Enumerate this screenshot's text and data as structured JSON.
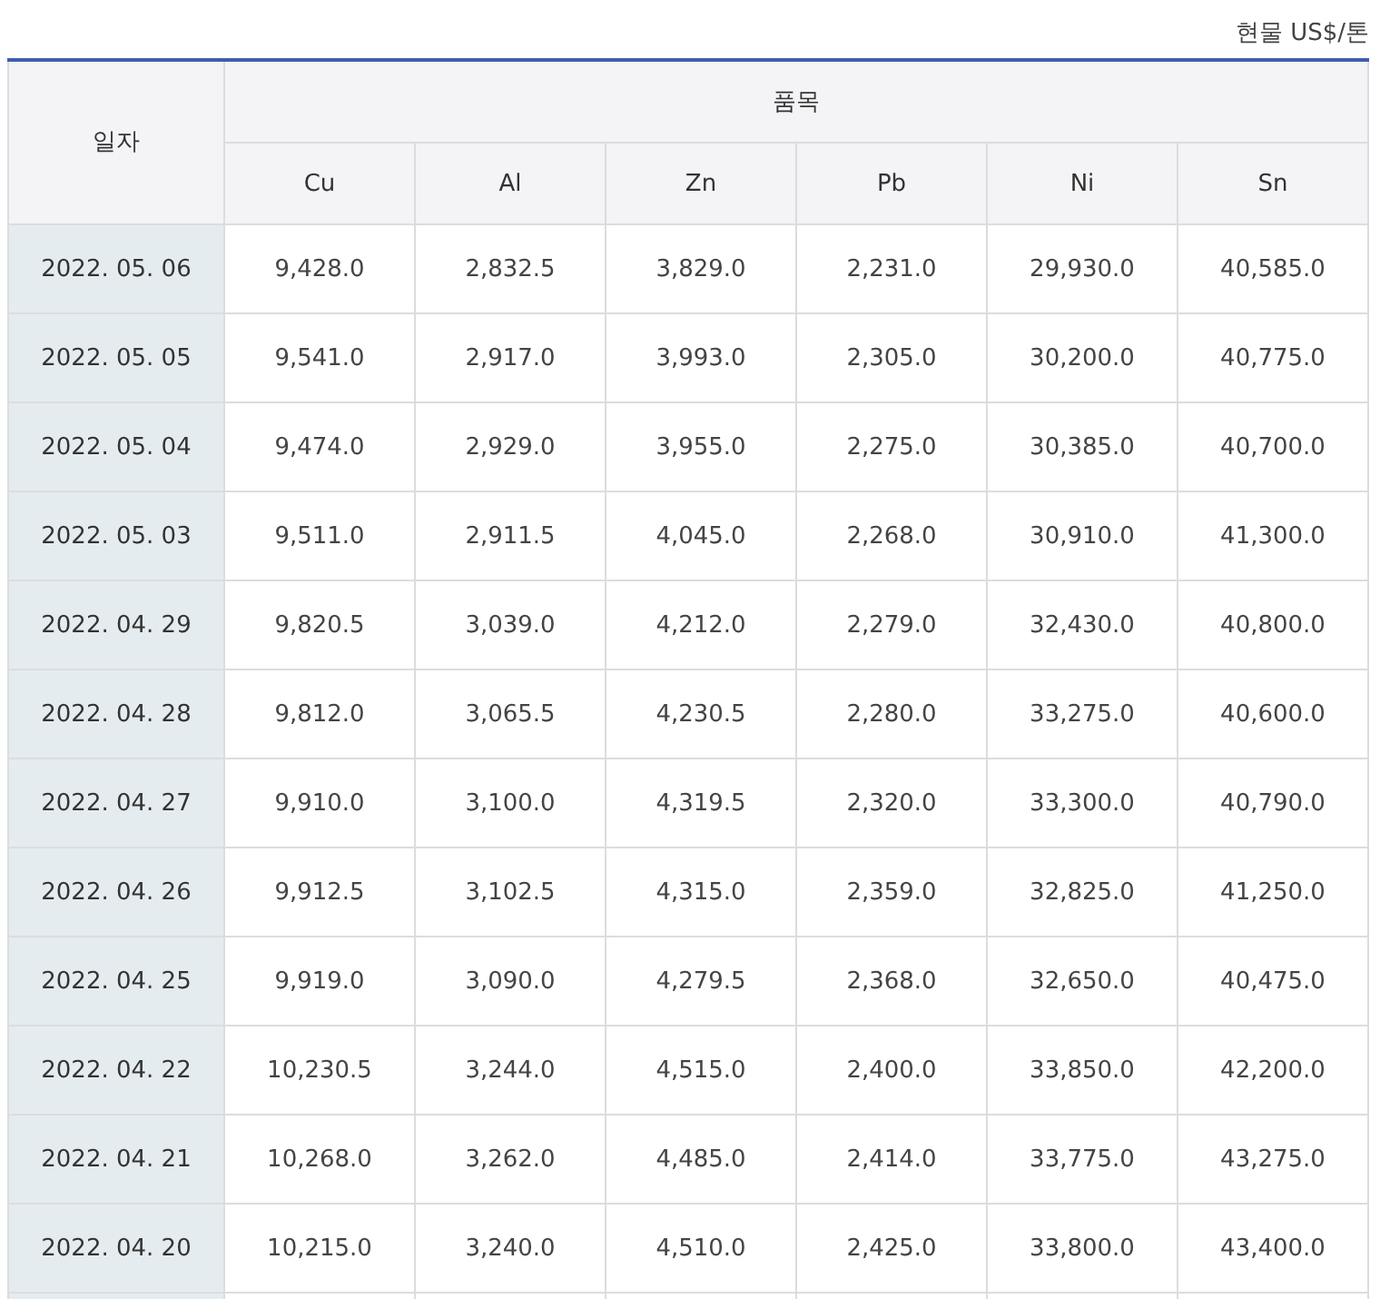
{
  "unit": "현물 US$/톤",
  "table": {
    "date_header": "일자",
    "group_header": "품목",
    "columns": [
      "Cu",
      "Al",
      "Zn",
      "Pb",
      "Ni",
      "Sn"
    ],
    "rows": [
      {
        "date": "2022. 05. 06",
        "values": [
          "9,428.0",
          "2,832.5",
          "3,829.0",
          "2,231.0",
          "29,930.0",
          "40,585.0"
        ]
      },
      {
        "date": "2022. 05. 05",
        "values": [
          "9,541.0",
          "2,917.0",
          "3,993.0",
          "2,305.0",
          "30,200.0",
          "40,775.0"
        ]
      },
      {
        "date": "2022. 05. 04",
        "values": [
          "9,474.0",
          "2,929.0",
          "3,955.0",
          "2,275.0",
          "30,385.0",
          "40,700.0"
        ]
      },
      {
        "date": "2022. 05. 03",
        "values": [
          "9,511.0",
          "2,911.5",
          "4,045.0",
          "2,268.0",
          "30,910.0",
          "41,300.0"
        ]
      },
      {
        "date": "2022. 04. 29",
        "values": [
          "9,820.5",
          "3,039.0",
          "4,212.0",
          "2,279.0",
          "32,430.0",
          "40,800.0"
        ]
      },
      {
        "date": "2022. 04. 28",
        "values": [
          "9,812.0",
          "3,065.5",
          "4,230.5",
          "2,280.0",
          "33,275.0",
          "40,600.0"
        ]
      },
      {
        "date": "2022. 04. 27",
        "values": [
          "9,910.0",
          "3,100.0",
          "4,319.5",
          "2,320.0",
          "33,300.0",
          "40,790.0"
        ]
      },
      {
        "date": "2022. 04. 26",
        "values": [
          "9,912.5",
          "3,102.5",
          "4,315.0",
          "2,359.0",
          "32,825.0",
          "41,250.0"
        ]
      },
      {
        "date": "2022. 04. 25",
        "values": [
          "9,919.0",
          "3,090.0",
          "4,279.5",
          "2,368.0",
          "32,650.0",
          "40,475.0"
        ]
      },
      {
        "date": "2022. 04. 22",
        "values": [
          "10,230.5",
          "3,244.0",
          "4,515.0",
          "2,400.0",
          "33,850.0",
          "42,200.0"
        ]
      },
      {
        "date": "2022. 04. 21",
        "values": [
          "10,268.0",
          "3,262.0",
          "4,485.0",
          "2,414.0",
          "33,775.0",
          "43,275.0"
        ]
      },
      {
        "date": "2022. 04. 20",
        "values": [
          "10,215.0",
          "3,240.0",
          "4,510.0",
          "2,425.0",
          "33,800.0",
          "43,400.0"
        ]
      }
    ]
  }
}
